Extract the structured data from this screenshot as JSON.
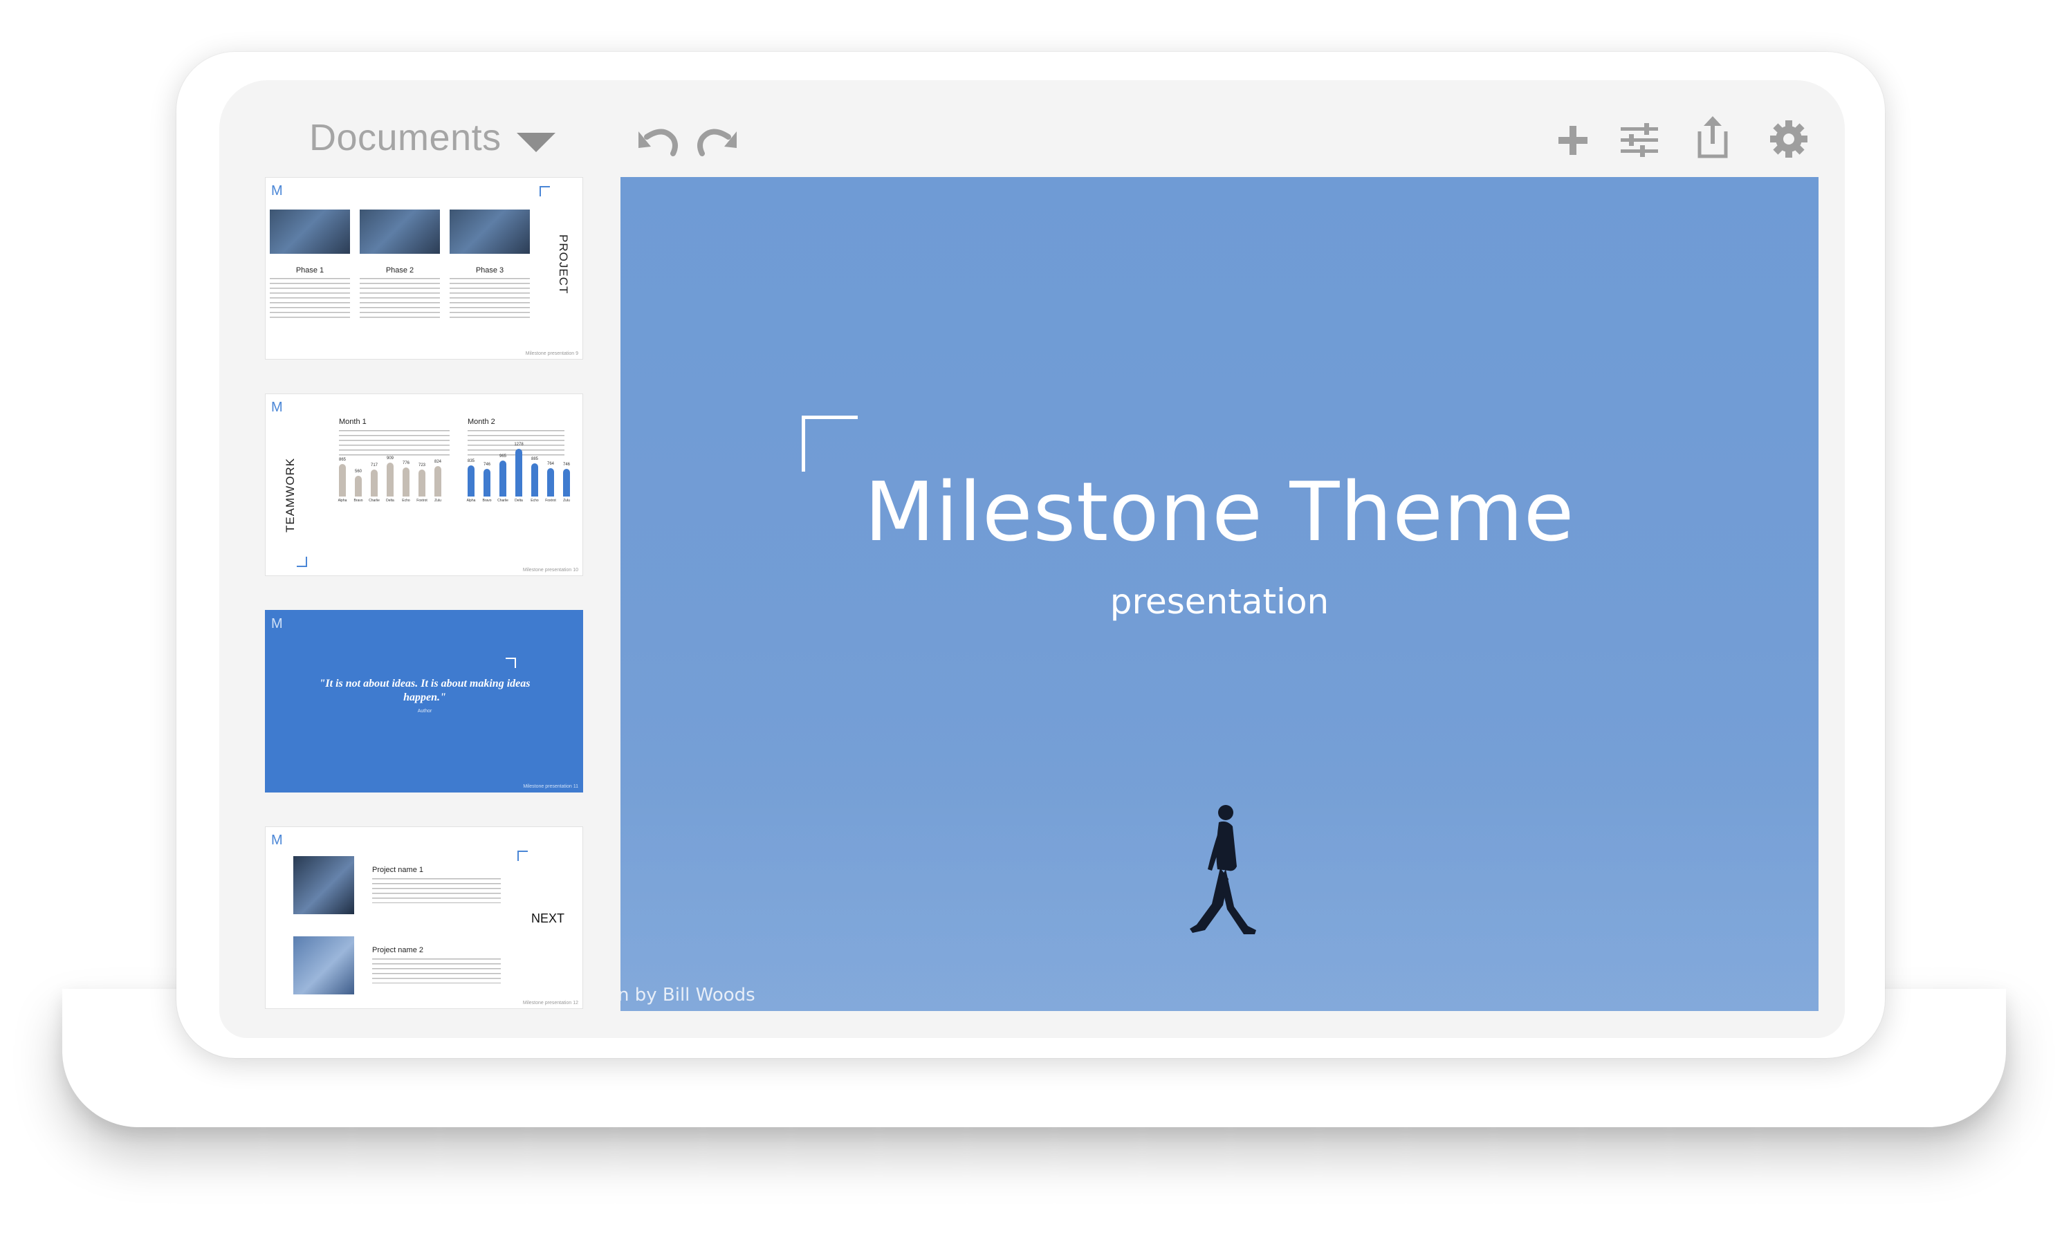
{
  "header": {
    "documents_label": "Documents"
  },
  "toolbar": {
    "undo_icon": "undo-icon",
    "redo_icon": "redo-icon",
    "add_icon": "plus-icon",
    "format_icon": "sliders-icon",
    "share_icon": "share-icon",
    "settings_icon": "gear-icon",
    "icon_color": "#9e9e9e"
  },
  "thumbnails": [
    {
      "logo": "M",
      "vertical_label": "PROJECT",
      "phases": [
        "Phase 1",
        "Phase 2",
        "Phase 3"
      ],
      "footer": "Milestone presentation 9"
    },
    {
      "logo": "M",
      "vertical_label": "TEAMWORK",
      "months": [
        "Month 1",
        "Month 2"
      ],
      "chart_data": [
        {
          "type": "bar",
          "categories": [
            "Alpha",
            "Bravo",
            "Charlie",
            "Delta",
            "Echo",
            "Foxtrot",
            "Zulu"
          ],
          "values": [
            865,
            560,
            717,
            909,
            776,
            723,
            824
          ],
          "color": "#c5bdb4"
        },
        {
          "type": "bar",
          "categories": [
            "Alpha",
            "Bravo",
            "Charlie",
            "Delta",
            "Echo",
            "Foxtrot",
            "Zulu"
          ],
          "values": [
            835,
            746,
            965,
            1278,
            885,
            764,
            746
          ],
          "color": "#3f7bcf"
        }
      ],
      "footer": "Milestone presentation 10"
    },
    {
      "logo": "M",
      "quote": "\"It is not about ideas. It is about making ideas happen.\"",
      "author": "Author",
      "footer": "Milestone presentation 11",
      "background": "#3f7bcf"
    },
    {
      "logo": "M",
      "projects": [
        "Project name 1",
        "Project name 2"
      ],
      "next_label": "NEXT",
      "footer": "Milestone presentation 12"
    }
  ],
  "slide": {
    "title": "Milestone Theme",
    "subtitle": "presentation",
    "credit": "n by Bill Woods",
    "background": "#739dd5"
  }
}
